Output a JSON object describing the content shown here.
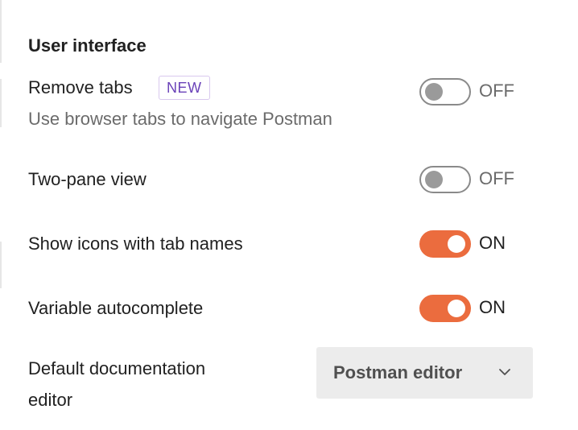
{
  "section": {
    "title": "User interface"
  },
  "settings": {
    "remove_tabs": {
      "label": "Remove tabs",
      "badge": "NEW",
      "description": "Use browser tabs to navigate Postman",
      "enabled": false,
      "state_label": "OFF"
    },
    "two_pane_view": {
      "label": "Two-pane view",
      "enabled": false,
      "state_label": "OFF"
    },
    "show_icons_with_tab_names": {
      "label": "Show icons with tab names",
      "enabled": true,
      "state_label": "ON"
    },
    "variable_autocomplete": {
      "label": "Variable autocomplete",
      "enabled": true,
      "state_label": "ON"
    },
    "default_documentation_editor": {
      "label_line1": "Default documentation",
      "label_line2": "editor",
      "selected_value": "Postman editor",
      "icon": "chevron-down-icon"
    }
  },
  "colors": {
    "accent": "#eb6c3e",
    "badge_text": "#6a42b8",
    "badge_border": "#d9c9ee",
    "dropdown_bg": "#ececec"
  }
}
